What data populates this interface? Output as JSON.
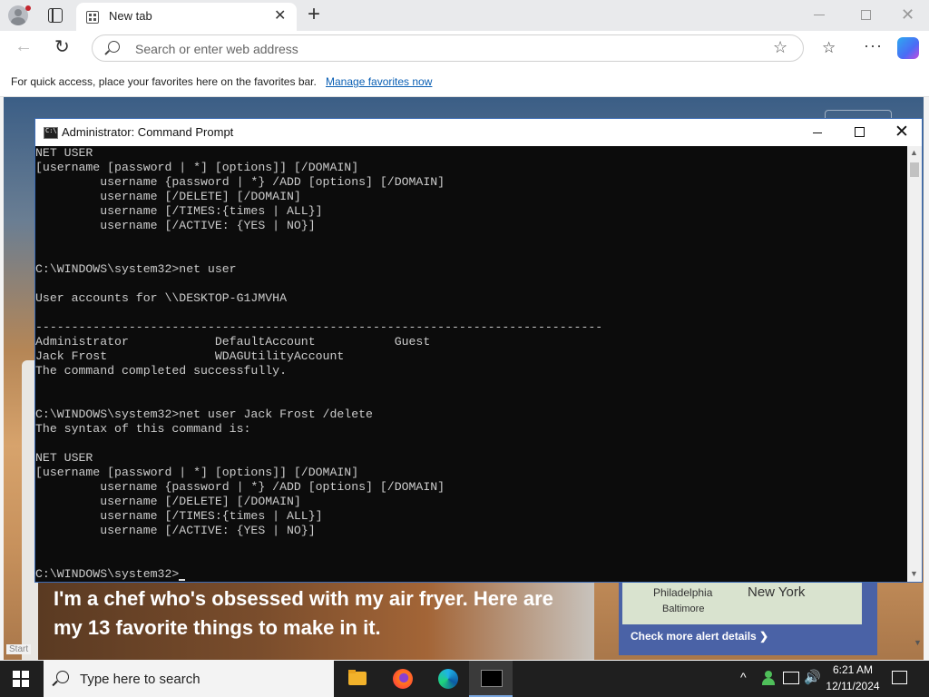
{
  "browser": {
    "tab_title": "New tab",
    "tab_close": "✕",
    "new_tab": "+",
    "win_close": "✕",
    "back": "←",
    "reload": "↻",
    "address_placeholder": "Search or enter web address",
    "star": "☆",
    "favorites_icon": "☆",
    "more": "···",
    "favbar_text": "For quick access, place your favorites here on the favorites bar.",
    "favbar_link": "Manage favorites now"
  },
  "newtab": {
    "headline": "I'm a chef who's obsessed with my air fryer. Here are my 13 favorite things to make in it.",
    "map_labels": [
      "Philadelphia",
      "Baltimore",
      "New York"
    ],
    "alert_link": "Check more alert details ❯",
    "start_label": "Start"
  },
  "cmd": {
    "title": "Administrator: Command Prompt",
    "close": "✕",
    "lines": [
      "NET USER",
      "[username [password | *] [options]] [/DOMAIN]",
      "         username {password | *} /ADD [options] [/DOMAIN]",
      "         username [/DELETE] [/DOMAIN]",
      "         username [/TIMES:{times | ALL}]",
      "         username [/ACTIVE: {YES | NO}]",
      "",
      "",
      "C:\\WINDOWS\\system32>net user",
      "",
      "User accounts for \\\\DESKTOP-G1JMVHA",
      "",
      "-------------------------------------------------------------------------------",
      "Administrator            DefaultAccount           Guest",
      "Jack Frost               WDAGUtilityAccount",
      "The command completed successfully.",
      "",
      "",
      "C:\\WINDOWS\\system32>net user Jack Frost /delete",
      "The syntax of this command is:",
      "",
      "NET USER",
      "[username [password | *] [options]] [/DOMAIN]",
      "         username {password | *} /ADD [options] [/DOMAIN]",
      "         username [/DELETE] [/DOMAIN]",
      "         username [/TIMES:{times | ALL}]",
      "         username [/ACTIVE: {YES | NO}]",
      "",
      "",
      "C:\\WINDOWS\\system32>"
    ],
    "scroll_up": "▲",
    "scroll_down": "▼"
  },
  "taskbar": {
    "search_placeholder": "Type here to search",
    "chevron": "^",
    "volume": "🔊",
    "time": "6:21 AM",
    "date": "12/11/2024"
  },
  "page_scroll_down": "▼"
}
